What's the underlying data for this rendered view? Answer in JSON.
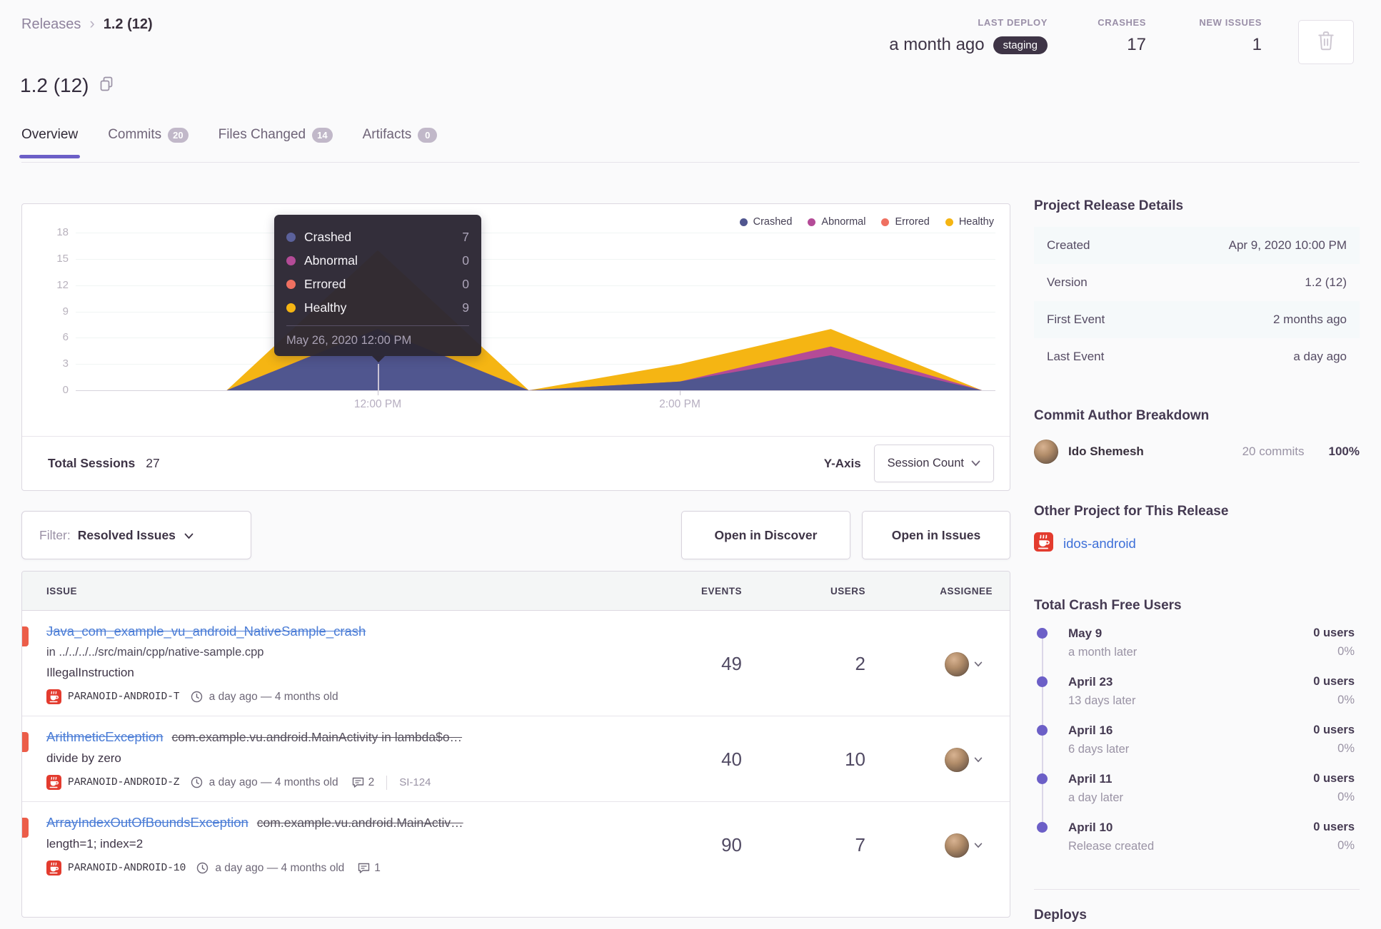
{
  "breadcrumb": {
    "parent": "Releases",
    "separator": "›",
    "current": "1.2 (12)"
  },
  "header_stats": {
    "last_deploy": {
      "label": "LAST DEPLOY",
      "value": "a month ago",
      "badge": "staging"
    },
    "crashes": {
      "label": "CRASHES",
      "value": "17"
    },
    "new_issues": {
      "label": "NEW ISSUES",
      "value": "1"
    }
  },
  "title": "1.2 (12)",
  "tabs": [
    {
      "label": "Overview",
      "badge": null,
      "active": true
    },
    {
      "label": "Commits",
      "badge": "20",
      "active": false
    },
    {
      "label": "Files Changed",
      "badge": "14",
      "active": false
    },
    {
      "label": "Artifacts",
      "badge": "0",
      "active": false
    }
  ],
  "colors": {
    "accent_purple": "#6c5fc7",
    "crashed": "#50568f",
    "abnormal": "#b44b97",
    "errored": "#ef7061",
    "healthy": "#f5b513",
    "level_error_red": "#ec5d49",
    "link_blue": "#4a7cd6"
  },
  "chart": {
    "legend": [
      {
        "label": "Crashed",
        "color": "#50568f"
      },
      {
        "label": "Abnormal",
        "color": "#b44b97"
      },
      {
        "label": "Errored",
        "color": "#ef7061"
      },
      {
        "label": "Healthy",
        "color": "#f5b513"
      }
    ],
    "tooltip": {
      "rows": [
        {
          "label": "Crashed",
          "value": "7",
          "color": "#5b619b"
        },
        {
          "label": "Abnormal",
          "value": "0",
          "color": "#b44b97"
        },
        {
          "label": "Errored",
          "value": "0",
          "color": "#ef7061"
        },
        {
          "label": "Healthy",
          "value": "9",
          "color": "#f5b513"
        }
      ],
      "date": "May 26, 2020 12:00 PM"
    },
    "y_ticks": [
      18,
      15,
      12,
      9,
      6,
      3,
      0
    ],
    "x_ticks": [
      "12:00 PM",
      "2:00 PM"
    ],
    "footer": {
      "total_label": "Total Sessions",
      "total_value": "27",
      "yaxis_label": "Y-Axis",
      "yaxis_value": "Session Count"
    }
  },
  "chart_data": {
    "type": "area",
    "stacked": true,
    "x": [
      "10:00 AM",
      "11:00 AM",
      "12:00 PM",
      "1:00 PM",
      "2:00 PM",
      "3:00 PM",
      "4:00 PM"
    ],
    "series": [
      {
        "name": "Crashed",
        "values": [
          0,
          0,
          7,
          0,
          1,
          4,
          0
        ]
      },
      {
        "name": "Abnormal",
        "values": [
          0,
          0,
          0,
          0,
          0,
          1,
          0
        ]
      },
      {
        "name": "Errored",
        "values": [
          0,
          0,
          0,
          0,
          0,
          0,
          0
        ]
      },
      {
        "name": "Healthy",
        "values": [
          0,
          0,
          9,
          0,
          2,
          2,
          0
        ]
      }
    ],
    "title": "Release sessions over time",
    "xlabel": "",
    "ylabel": "Session Count",
    "ylim": [
      0,
      18
    ],
    "legend_position": "top-right",
    "grid": true
  },
  "filter_bar": {
    "filter_label": "Filter:",
    "filter_value": "Resolved Issues",
    "open_discover": "Open in Discover",
    "open_issues": "Open in Issues"
  },
  "issues_table": {
    "columns": [
      "ISSUE",
      "EVENTS",
      "USERS",
      "ASSIGNEE"
    ],
    "rows": [
      {
        "title": "Java_com_example_vu_android_NativeSample_crash",
        "culprit": null,
        "location": "in ../../../../src/main/cpp/native-sample.cpp",
        "message": "IllegalInstruction",
        "project": "PARANOID-ANDROID-T",
        "age": "a day ago — 4 months old",
        "comments": null,
        "ref": null,
        "events": "49",
        "users": "2"
      },
      {
        "title": "ArithmeticException",
        "culprit": "com.example.vu.android.MainActivity in lambda$o…",
        "location": null,
        "message": "divide by zero",
        "project": "PARANOID-ANDROID-Z",
        "age": "a day ago — 4 months old",
        "comments": "2",
        "ref": "SI-124",
        "events": "40",
        "users": "10"
      },
      {
        "title": "ArrayIndexOutOfBoundsException",
        "culprit": "com.example.vu.android.MainActiv…",
        "location": null,
        "message": "length=1; index=2",
        "project": "PARANOID-ANDROID-10",
        "age": "a day ago — 4 months old",
        "comments": "1",
        "ref": null,
        "events": "90",
        "users": "7"
      }
    ]
  },
  "sidebar": {
    "release_details": {
      "heading": "Project Release Details",
      "rows": [
        {
          "label": "Created",
          "value": "Apr 9, 2020 10:00 PM"
        },
        {
          "label": "Version",
          "value": "1.2 (12)"
        },
        {
          "label": "First Event",
          "value": "2 months ago"
        },
        {
          "label": "Last Event",
          "value": "a day ago"
        }
      ]
    },
    "commit_authors": {
      "heading": "Commit Author Breakdown",
      "author": {
        "name": "Ido Shemesh",
        "commits": "20 commits",
        "percent": "100%"
      }
    },
    "other_project": {
      "heading": "Other Project for This Release",
      "link": "idos-android"
    },
    "crash_free": {
      "heading": "Total Crash Free Users",
      "entries": [
        {
          "date": "May 9",
          "rel": "a month later",
          "users": "0 users",
          "pct": "0%"
        },
        {
          "date": "April 23",
          "rel": "13 days later",
          "users": "0 users",
          "pct": "0%"
        },
        {
          "date": "April 16",
          "rel": "6 days later",
          "users": "0 users",
          "pct": "0%"
        },
        {
          "date": "April 11",
          "rel": "a day later",
          "users": "0 users",
          "pct": "0%"
        },
        {
          "date": "April 10",
          "rel": "Release created",
          "users": "0 users",
          "pct": "0%"
        }
      ]
    },
    "deploys_heading": "Deploys"
  }
}
